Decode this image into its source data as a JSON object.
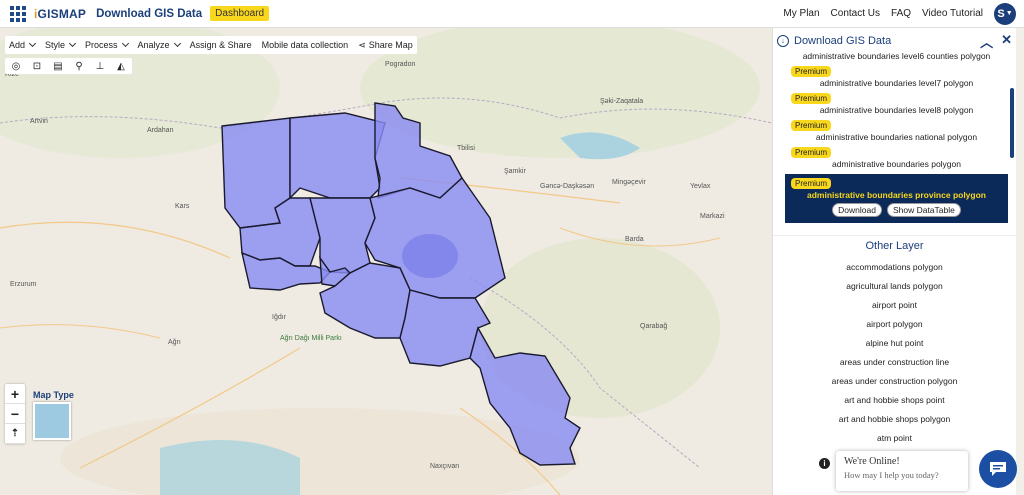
{
  "header": {
    "logo": "IGISMAP",
    "title": "Download GIS Data",
    "dashboard": "Dashboard",
    "links": [
      "My Plan",
      "Contact Us",
      "FAQ",
      "Video Tutorial"
    ],
    "avatar": "S"
  },
  "toolbar": {
    "menus": [
      "Add",
      "Style",
      "Process",
      "Analyze"
    ],
    "assign": "Assign & Share",
    "mobile": "Mobile data collection",
    "share": "Share Map"
  },
  "map_labels": [
    "Artvin",
    "Ardahan",
    "Kars",
    "Iğdır",
    "Ağrı",
    "Rize",
    "Erzurum",
    "Tbilisi",
    "Şamkir",
    "Mingəçevir",
    "Barda",
    "Yevlax",
    "Gəncə-Daşkəsən",
    "Naxçıvan",
    "Ağrı Dağı Milli Parkı",
    "Şəki-Zaqatala",
    "Qarabağ",
    "Markazi",
    "Pogradon"
  ],
  "map": {
    "maptype_label": "Map Type"
  },
  "panel": {
    "title": "Download GIS Data",
    "top_layer": "administrative boundaries level6 counties polygon",
    "premium": "Premium",
    "premium_layers": [
      "administrative boundaries level7 polygon",
      "administrative boundaries level8 polygon",
      "administrative boundaries national polygon",
      "administrative boundaries polygon"
    ],
    "selected_layer": "administrative boundaries province polygon",
    "download_btn": "Download",
    "datatable_btn": "Show DataTable",
    "other_title": "Other Layer",
    "other_layers": [
      "accommodations polygon",
      "agricultural lands polygon",
      "airport point",
      "airport polygon",
      "alpine hut point",
      "areas under construction line",
      "areas under construction polygon",
      "art and hobbie shops point",
      "art and hobbie shops polygon",
      "atm point"
    ]
  },
  "chat": {
    "online": "We're Online!",
    "help": "How may I help you today?"
  },
  "colors": {
    "brand": "#1b3f7a",
    "accent": "#f9d71c",
    "polygon_fill": "#8a8cf2"
  }
}
